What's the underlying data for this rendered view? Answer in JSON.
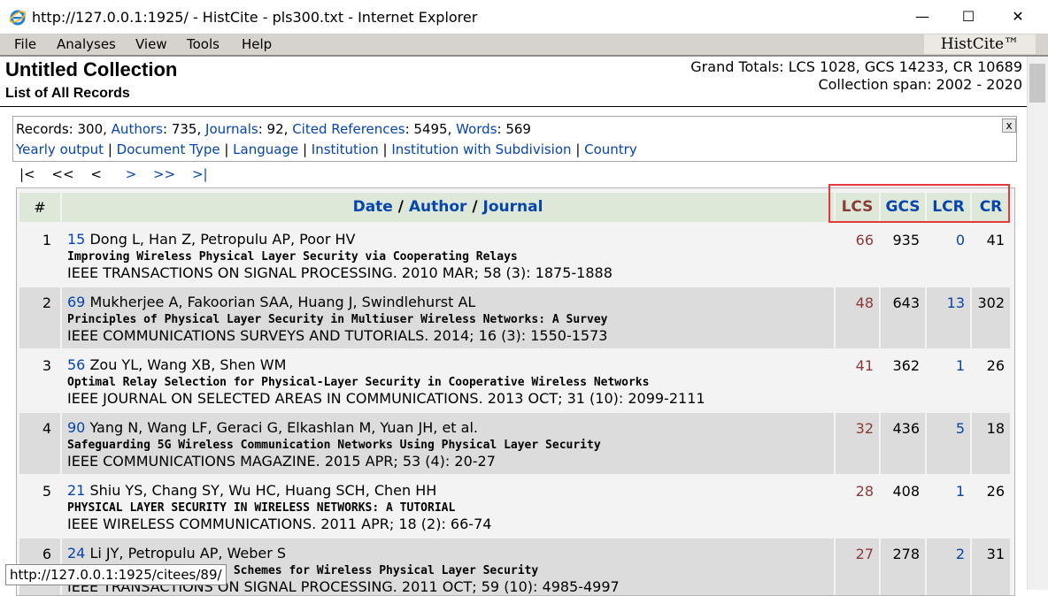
{
  "window": {
    "title": "http://127.0.0.1:1925/ - HistCite - pls300.txt - Internet Explorer",
    "minimize": "—",
    "maximize": "☐",
    "close": "✕"
  },
  "menu": {
    "items": [
      "File",
      "Analyses",
      "View",
      "Tools",
      "Help"
    ],
    "brand": "HistCite™"
  },
  "page": {
    "title": "Untitled Collection",
    "subtitle": "List of All Records",
    "grand_totals": "Grand Totals: LCS 1028, GCS 14233, CR 10689",
    "collection_span": "Collection span: 2002 - 2020"
  },
  "stats": {
    "records_label": "Records:",
    "records_value": "300",
    "authors_label": "Authors",
    "authors_value": "735",
    "journals_label": "Journals",
    "journals_value": "92",
    "cited_label": "Cited References",
    "cited_value": "5495",
    "words_label": "Words",
    "words_value": "569",
    "close": "x",
    "links": [
      "Yearly output",
      "Document Type",
      "Language",
      "Institution",
      "Institution with Subdivision",
      "Country"
    ]
  },
  "pager": [
    "|<",
    "<<",
    "<",
    ">",
    ">>",
    ">|"
  ],
  "table": {
    "headers": {
      "num": "#",
      "date": "Date",
      "author": "Author",
      "journal": "Journal",
      "slash": "/",
      "lcs": "LCS",
      "gcs": "GCS",
      "lcr": "LCR",
      "cr": "CR"
    },
    "rows": [
      {
        "num": "1",
        "id": "15",
        "authors": "Dong L, Han Z, Petropulu AP, Poor HV",
        "title": "Improving Wireless Physical Layer Security via Cooperating Relays",
        "source": "IEEE TRANSACTIONS ON SIGNAL PROCESSING. 2010 MAR; 58 (3): 1875-1888",
        "lcs": "66",
        "gcs": "935",
        "lcr": "0",
        "cr": "41"
      },
      {
        "num": "2",
        "id": "69",
        "authors": "Mukherjee A, Fakoorian SAA, Huang J, Swindlehurst AL",
        "title": "Principles of Physical Layer Security in Multiuser Wireless Networks: A Survey",
        "source": "IEEE COMMUNICATIONS SURVEYS AND TUTORIALS. 2014; 16 (3): 1550-1573",
        "lcs": "48",
        "gcs": "643",
        "lcr": "13",
        "cr": "302"
      },
      {
        "num": "3",
        "id": "56",
        "authors": "Zou YL, Wang XB, Shen WM",
        "title": "Optimal Relay Selection for Physical-Layer Security in Cooperative Wireless Networks",
        "source": "IEEE JOURNAL ON SELECTED AREAS IN COMMUNICATIONS. 2013 OCT; 31 (10): 2099-2111",
        "lcs": "41",
        "gcs": "362",
        "lcr": "1",
        "cr": "26"
      },
      {
        "num": "4",
        "id": "90",
        "authors": "Yang N, Wang LF, Geraci G, Elkashlan M, Yuan JH, et al.",
        "title": "Safeguarding 5G Wireless Communication Networks Using Physical Layer Security",
        "source": "IEEE COMMUNICATIONS MAGAZINE. 2015 APR; 53 (4): 20-27",
        "lcs": "32",
        "gcs": "436",
        "lcr": "5",
        "cr": "18"
      },
      {
        "num": "5",
        "id": "21",
        "authors": "Shiu YS, Chang SY, Wu HC, Huang SCH, Chen HH",
        "title": "PHYSICAL LAYER SECURITY IN WIRELESS NETWORKS: A TUTORIAL",
        "source": "IEEE WIRELESS COMMUNICATIONS. 2011 APR; 18 (2): 66-74",
        "lcs": "28",
        "gcs": "408",
        "lcr": "1",
        "cr": "26"
      },
      {
        "num": "6",
        "id": "24",
        "authors": "Li JY, Petropulu AP, Weber S",
        "title": "On Cooperative Relaying Schemes for Wireless Physical Layer Security",
        "source": "IEEE TRANSACTIONS ON SIGNAL PROCESSING. 2011 OCT; 59 (10): 4985-4997",
        "lcs": "27",
        "gcs": "278",
        "lcr": "2",
        "cr": "31"
      }
    ]
  },
  "statusbar": {
    "tooltip": "http://127.0.0.1:1925/citees/89/"
  },
  "colors": {
    "link": "#0645ad",
    "lcs": "#8b3a3a",
    "header_bg": "#dde8d8",
    "highlight_box": "#e33a3a",
    "ie_blue": "#1e7fd8"
  }
}
